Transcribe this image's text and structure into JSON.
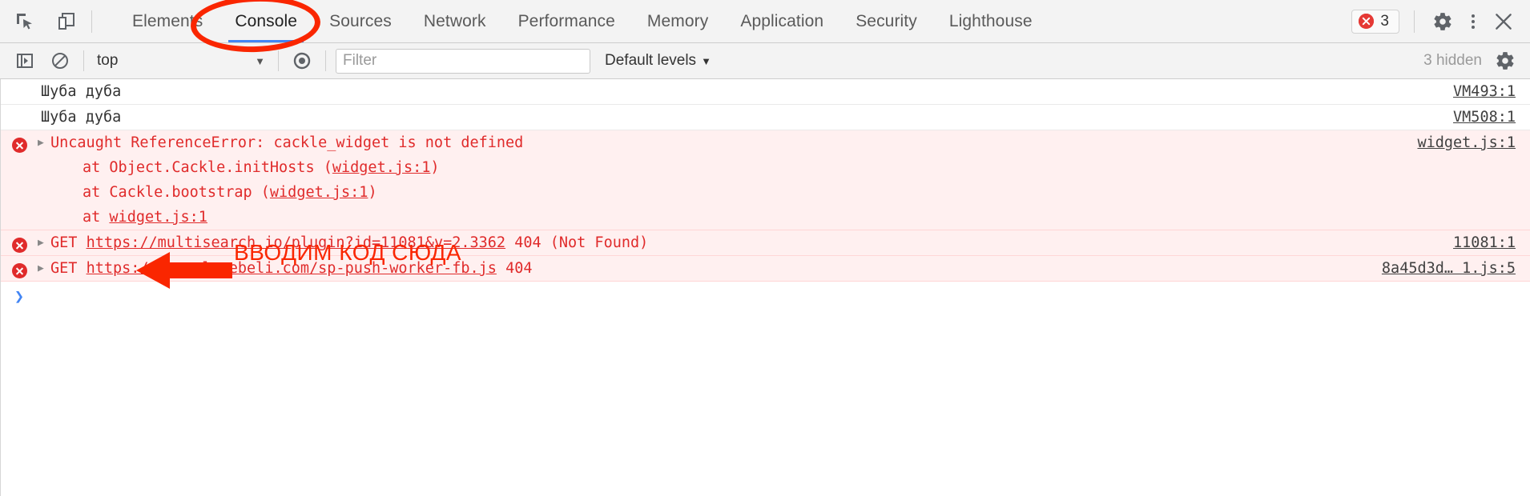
{
  "toolbar": {
    "inspect_icon": "inspect-element-icon",
    "device_icon": "device-toolbar-icon",
    "tabs": [
      {
        "label": "Elements",
        "active": false
      },
      {
        "label": "Console",
        "active": true
      },
      {
        "label": "Sources",
        "active": false
      },
      {
        "label": "Network",
        "active": false
      },
      {
        "label": "Performance",
        "active": false
      },
      {
        "label": "Memory",
        "active": false
      },
      {
        "label": "Application",
        "active": false
      },
      {
        "label": "Security",
        "active": false
      },
      {
        "label": "Lighthouse",
        "active": false
      }
    ],
    "error_count": "3",
    "settings_icon": "gear-icon",
    "more_icon": "kebab-menu-icon",
    "close_icon": "close-icon"
  },
  "filterbar": {
    "sidebar_toggle_icon": "show-console-sidebar-icon",
    "clear_icon": "clear-console-icon",
    "context": "top",
    "context_caret": "▼",
    "eye_icon": "live-expression-icon",
    "filter_value": "",
    "filter_placeholder": "Filter",
    "levels_label": "Default levels",
    "levels_caret": "▼",
    "hidden_label": "3 hidden",
    "settings_icon": "console-settings-gear-icon"
  },
  "console": {
    "messages": [
      {
        "type": "log",
        "text": "Шуба дуба",
        "source": "VM493:1"
      },
      {
        "type": "log",
        "text": "Шуба дуба",
        "source": "VM508:1"
      },
      {
        "type": "error",
        "text": "Uncaught ReferenceError: cackle_widget is not defined",
        "stack": [
          {
            "prefix": "at Object.Cackle.initHosts (",
            "link": "widget.js:1",
            "suffix": ")"
          },
          {
            "prefix": "at Cackle.bootstrap (",
            "link": "widget.js:1",
            "suffix": ")"
          },
          {
            "prefix": "at ",
            "link": "widget.js:1",
            "suffix": ""
          }
        ],
        "source": "widget.js:1"
      },
      {
        "type": "error",
        "method": "GET",
        "url": "https://multisearch.io/plugin?id=11081&v=2.3362",
        "status": "404 (Not Found)",
        "source": "11081:1"
      },
      {
        "type": "error",
        "method": "GET",
        "url": "https://formulamebeli.com/sp-push-worker-fb.js",
        "status": "404",
        "source": "8a45d3d… 1.js:5"
      }
    ],
    "prompt_chevron": "❯",
    "prompt_value": ""
  },
  "annotations": {
    "ellipse_target": "Console",
    "arrow_label": "ВВОДИМ КОД СЮДА",
    "color": "#fa2600"
  }
}
